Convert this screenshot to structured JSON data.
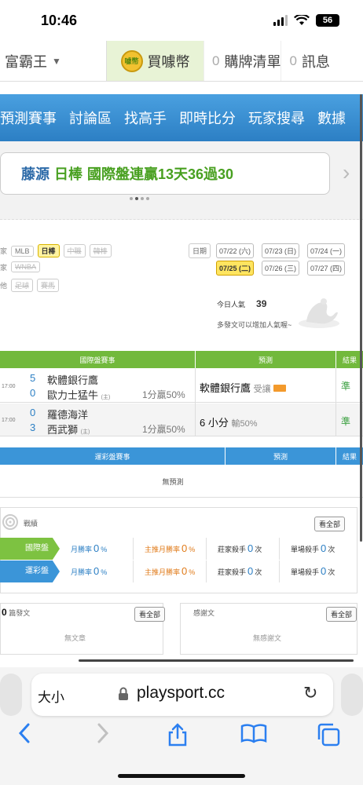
{
  "status": {
    "time": "10:46",
    "battery": "56"
  },
  "topnav": {
    "brand": "富霸王",
    "coin_label": "買噱幣",
    "coin_icon_text": "噱幣",
    "cart_count": "0",
    "cart_label": "購牌清單",
    "msg_count": "0",
    "msg_label": "訊息"
  },
  "menu": [
    "預測賽事",
    "討論區",
    "找高手",
    "即時比分",
    "玩家搜尋",
    "數據"
  ],
  "banner": {
    "name": "藤源",
    "league": "日棒",
    "text": "國際盤連贏13天36過30"
  },
  "filters": {
    "row1_label": "家",
    "row1": [
      "MLB",
      "日棒",
      "中職",
      "韓棒"
    ],
    "row2_label": "家",
    "row2": [
      "WNBA"
    ],
    "row3_label": "他",
    "row3": [
      "足球",
      "賽馬"
    ],
    "date_label": "日期",
    "dates": [
      "07/22 (六)",
      "07/23 (日)",
      "07/24 (一)",
      "07/25 (二)",
      "07/26 (三)",
      "07/27 (四)"
    ]
  },
  "popularity": {
    "label": "今日人氣",
    "value": "39",
    "hint": "多發文可以增加人氣喔~"
  },
  "intl_table": {
    "header": {
      "match": "國際盤賽事",
      "pred": "預測",
      "result": "結果"
    },
    "rows": [
      {
        "time": "17:00",
        "team1_score": "5",
        "team1": "軟體銀行鷹",
        "team2_score": "0",
        "team2": "歐力士猛牛",
        "host_mark": "(主)",
        "odds": "1分贏50%",
        "prediction": "軟體銀行鷹",
        "pred_note": "受讓",
        "result": "準"
      },
      {
        "time": "17:00",
        "team1_score": "0",
        "team1": "羅德海洋",
        "team2_score": "3",
        "team2": "西武獅",
        "host_mark": "(主)",
        "odds": "1分贏50%",
        "prediction": "6 小分",
        "pred_note": "輸50%",
        "result": "準"
      }
    ]
  },
  "lottery_table": {
    "header": {
      "match": "運彩盤賽事",
      "pred": "預測",
      "result": "結果"
    },
    "empty": "無預測"
  },
  "record": {
    "title": "戰績",
    "view_all": "看全部",
    "rows": [
      {
        "label": "國際盤",
        "color": "#7dc241",
        "cells": [
          {
            "name": "月勝率",
            "value": "0",
            "unit": "%",
            "color": "#2c7fc4"
          },
          {
            "name": "主推月勝率",
            "value": "0",
            "unit": "%",
            "color": "#e07b1a"
          },
          {
            "name": "莊家殺手",
            "value": "0",
            "unit": "次",
            "color": "#333"
          },
          {
            "name": "單場殺手",
            "value": "0",
            "unit": "次",
            "color": "#333"
          }
        ]
      },
      {
        "label": "運彩盤",
        "color": "#3b95d8",
        "cells": [
          {
            "name": "月勝率",
            "value": "0",
            "unit": "%",
            "color": "#2c7fc4"
          },
          {
            "name": "主推月勝率",
            "value": "0",
            "unit": "%",
            "color": "#e07b1a"
          },
          {
            "name": "莊家殺手",
            "value": "0",
            "unit": "次",
            "color": "#333"
          },
          {
            "name": "單場殺手",
            "value": "0",
            "unit": "次",
            "color": "#333"
          }
        ]
      }
    ]
  },
  "articles": {
    "count": "0",
    "title": "篇發文",
    "view_all": "看全部",
    "empty": "無文章"
  },
  "thanks": {
    "title": "感謝文",
    "view_all": "看全部",
    "empty": "無感謝文"
  },
  "safari": {
    "text_size": "大小",
    "url": "playsport.cc"
  }
}
